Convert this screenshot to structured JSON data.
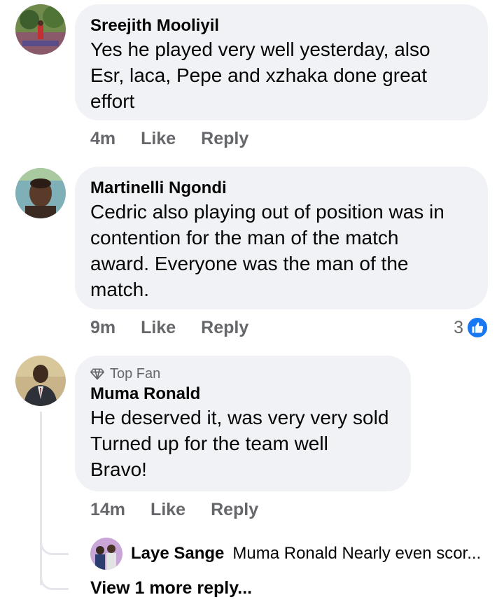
{
  "comments": [
    {
      "author": "Sreejith Mooliyil",
      "text": "Yes he played very well yesterday,  also\nEsr, laca, Pepe and xzhaka done great\neffort",
      "time": "4m",
      "like_label": "Like",
      "reply_label": "Reply"
    },
    {
      "author": "Martinelli Ngondi",
      "text": "Cedric also playing out of position was in\ncontention for the man of the match\naward. Everyone was the man of the\nmatch.",
      "time": "9m",
      "like_label": "Like",
      "reply_label": "Reply",
      "reaction_count": "3"
    },
    {
      "badge": "Top Fan",
      "author": "Muma Ronald",
      "text": "He deserved it, was very very sold\nTurned up for the team well\nBravo!",
      "time": "14m",
      "like_label": "Like",
      "reply_label": "Reply"
    }
  ],
  "reply_preview": {
    "author": "Laye Sange",
    "text": "Muma Ronald Nearly even scor..."
  },
  "view_more_label": "View 1 more reply...",
  "colors": {
    "bubble": "#f0f2f5",
    "meta_text": "#65676b",
    "like_blue": "#1877f2",
    "thread_line": "#e4e6eb"
  }
}
